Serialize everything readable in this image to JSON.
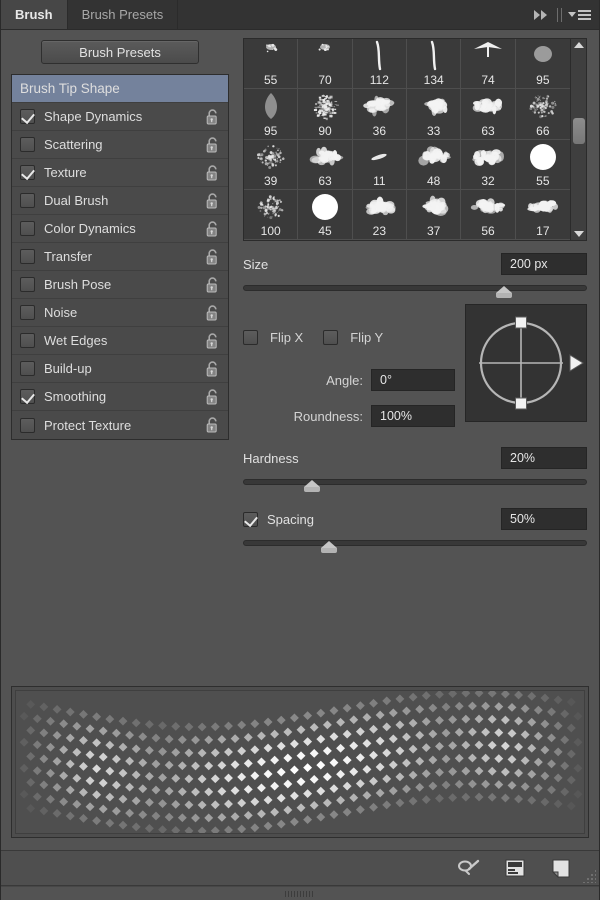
{
  "window": {
    "title": "Brush"
  },
  "tabs": [
    {
      "label": "Brush",
      "active": true
    },
    {
      "label": "Brush Presets",
      "active": false
    }
  ],
  "header_controls": {
    "collapse_icon": "double-chevron-right-icon",
    "menu_icon": "panel-menu-icon"
  },
  "sidebar": {
    "presets_button": "Brush Presets",
    "items": [
      {
        "label": "Brush Tip Shape",
        "selected": true,
        "checkbox": false,
        "checked": false,
        "lock": false
      },
      {
        "label": "Shape Dynamics",
        "selected": false,
        "checkbox": true,
        "checked": true,
        "lock": true
      },
      {
        "label": "Scattering",
        "selected": false,
        "checkbox": true,
        "checked": false,
        "lock": true
      },
      {
        "label": "Texture",
        "selected": false,
        "checkbox": true,
        "checked": true,
        "lock": true
      },
      {
        "label": "Dual Brush",
        "selected": false,
        "checkbox": true,
        "checked": false,
        "lock": true
      },
      {
        "label": "Color Dynamics",
        "selected": false,
        "checkbox": true,
        "checked": false,
        "lock": true
      },
      {
        "label": "Transfer",
        "selected": false,
        "checkbox": true,
        "checked": false,
        "lock": true
      },
      {
        "label": "Brush Pose",
        "selected": false,
        "checkbox": true,
        "checked": false,
        "lock": true
      },
      {
        "label": "Noise",
        "selected": false,
        "checkbox": true,
        "checked": false,
        "lock": true
      },
      {
        "label": "Wet Edges",
        "selected": false,
        "checkbox": true,
        "checked": false,
        "lock": true
      },
      {
        "label": "Build-up",
        "selected": false,
        "checkbox": true,
        "checked": false,
        "lock": true
      },
      {
        "label": "Smoothing",
        "selected": false,
        "checkbox": true,
        "checked": true,
        "lock": true
      },
      {
        "label": "Protect Texture",
        "selected": false,
        "checkbox": true,
        "checked": false,
        "lock": true
      }
    ]
  },
  "brush_grid": {
    "columns": 6,
    "rows": 4,
    "scrollbar": {
      "up_arrow": "scroll-up-arrow",
      "down_arrow": "scroll-down-arrow",
      "thumb_position_pct": 38
    },
    "presets": [
      {
        "size": "55",
        "shape": "spatter-small"
      },
      {
        "size": "70",
        "shape": "spatter-small"
      },
      {
        "size": "112",
        "shape": "stroke-thin"
      },
      {
        "size": "134",
        "shape": "stroke-thin"
      },
      {
        "size": "74",
        "shape": "fan-stroke"
      },
      {
        "size": "95",
        "shape": "soft-blob"
      },
      {
        "size": "95",
        "shape": "leaf"
      },
      {
        "size": "90",
        "shape": "rough-round"
      },
      {
        "size": "36",
        "shape": "chalk-clump"
      },
      {
        "size": "33",
        "shape": "chalk-clump"
      },
      {
        "size": "63",
        "shape": "chalk-clump"
      },
      {
        "size": "66",
        "shape": "speckle-scatter"
      },
      {
        "size": "39",
        "shape": "speckle-scatter"
      },
      {
        "size": "63",
        "shape": "chalk-clump"
      },
      {
        "size": "11",
        "shape": "stroke-tiny"
      },
      {
        "size": "48",
        "shape": "chalk-clump"
      },
      {
        "size": "32",
        "shape": "chalk-clump"
      },
      {
        "size": "55",
        "shape": "hard-round"
      },
      {
        "size": "100",
        "shape": "speckle-scatter"
      },
      {
        "size": "45",
        "shape": "hard-round"
      },
      {
        "size": "23",
        "shape": "chalk-clump"
      },
      {
        "size": "37",
        "shape": "chalk-clump"
      },
      {
        "size": "56",
        "shape": "chalk-clump"
      },
      {
        "size": "17",
        "shape": "chalk-clump"
      }
    ]
  },
  "controls": {
    "size": {
      "label": "Size",
      "value": "200 px",
      "slider_pct": 76
    },
    "flip_x": {
      "label": "Flip X",
      "checked": false
    },
    "flip_y": {
      "label": "Flip Y",
      "checked": false
    },
    "angle": {
      "label": "Angle:",
      "value": "0°"
    },
    "roundness": {
      "label": "Roundness:",
      "value": "100%"
    },
    "hardness": {
      "label": "Hardness",
      "value": "20%",
      "slider_pct": 20
    },
    "spacing": {
      "label": "Spacing",
      "value": "50%",
      "slider_pct": 25,
      "checked": true
    },
    "angle_widget": {
      "name": "angle-roundness-dial",
      "handle_top": "dial-handle-top",
      "handle_bottom": "dial-handle-bottom",
      "arrow": "dial-direction-arrow"
    }
  },
  "preview": {
    "name": "brush-stroke-preview",
    "description": "dotted stipple wave stroke"
  },
  "bottom_bar": {
    "icons": [
      {
        "name": "toggle-brush-settings-icon"
      },
      {
        "name": "open-preset-manager-icon"
      },
      {
        "name": "create-new-brush-icon"
      }
    ],
    "resize_grip": "panel-resize-grip",
    "drag_grip": "panel-drag-grip"
  },
  "colors": {
    "panel_bg": "#535353",
    "list_bg": "#4a4a4a",
    "selected_row": "#74829c",
    "field_bg": "#2e2e2e",
    "tab_active": "#474747",
    "tab_inactive": "#333333"
  }
}
